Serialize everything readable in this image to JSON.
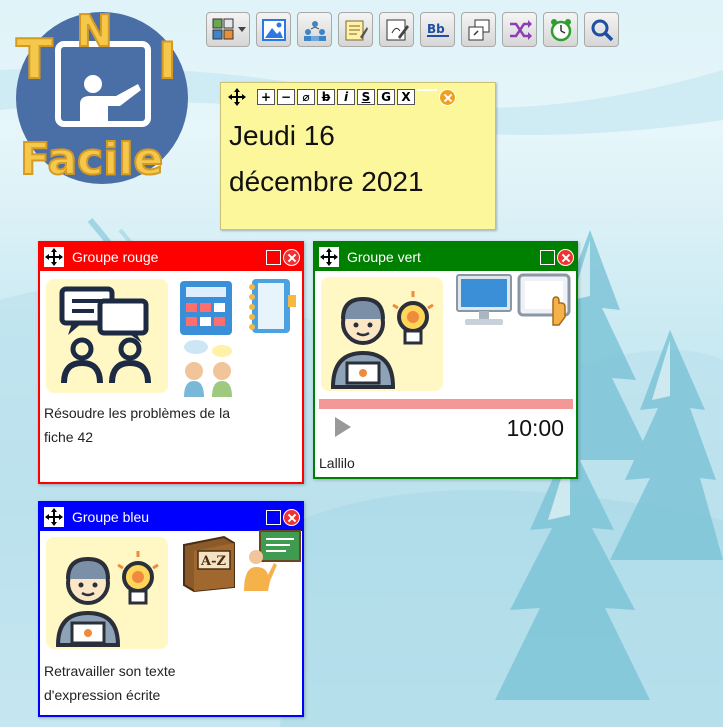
{
  "logo": {
    "line1": "TNI",
    "line2": "Facile"
  },
  "toolbar": {
    "items": [
      {
        "icon": "layout-grid-icon"
      },
      {
        "icon": "image-icon"
      },
      {
        "icon": "groups-icon"
      },
      {
        "icon": "notepad-icon"
      },
      {
        "icon": "edit-sheet-icon"
      },
      {
        "icon": "text-underline-icon"
      },
      {
        "icon": "window-stack-icon"
      },
      {
        "icon": "shuffle-icon"
      },
      {
        "icon": "alarm-clock-icon"
      },
      {
        "icon": "search-icon"
      }
    ]
  },
  "date_widget": {
    "buttons": [
      "+",
      "−",
      "⌀",
      "b",
      "i",
      "S",
      "G",
      "X"
    ],
    "line1": "Jeudi 16",
    "line2": "décembre 2021"
  },
  "groups": {
    "red": {
      "title": "Groupe rouge",
      "color": "#ff0000",
      "text_line1": "Résoudre les problèmes de la",
      "text_line2": "fiche 42"
    },
    "green": {
      "title": "Groupe vert",
      "color": "#008000",
      "timer": "10:00",
      "timer_progress": 1.0,
      "caption": "Lallilo"
    },
    "blue": {
      "title": "Groupe bleu",
      "color": "#0000ff",
      "text_line1": "Retravailler son texte",
      "text_line2": "d'expression écrite"
    }
  },
  "colors": {
    "yellow_note": "#fdf79c",
    "tile_background": "#fff7c4",
    "timer_bar": "#f49897"
  }
}
